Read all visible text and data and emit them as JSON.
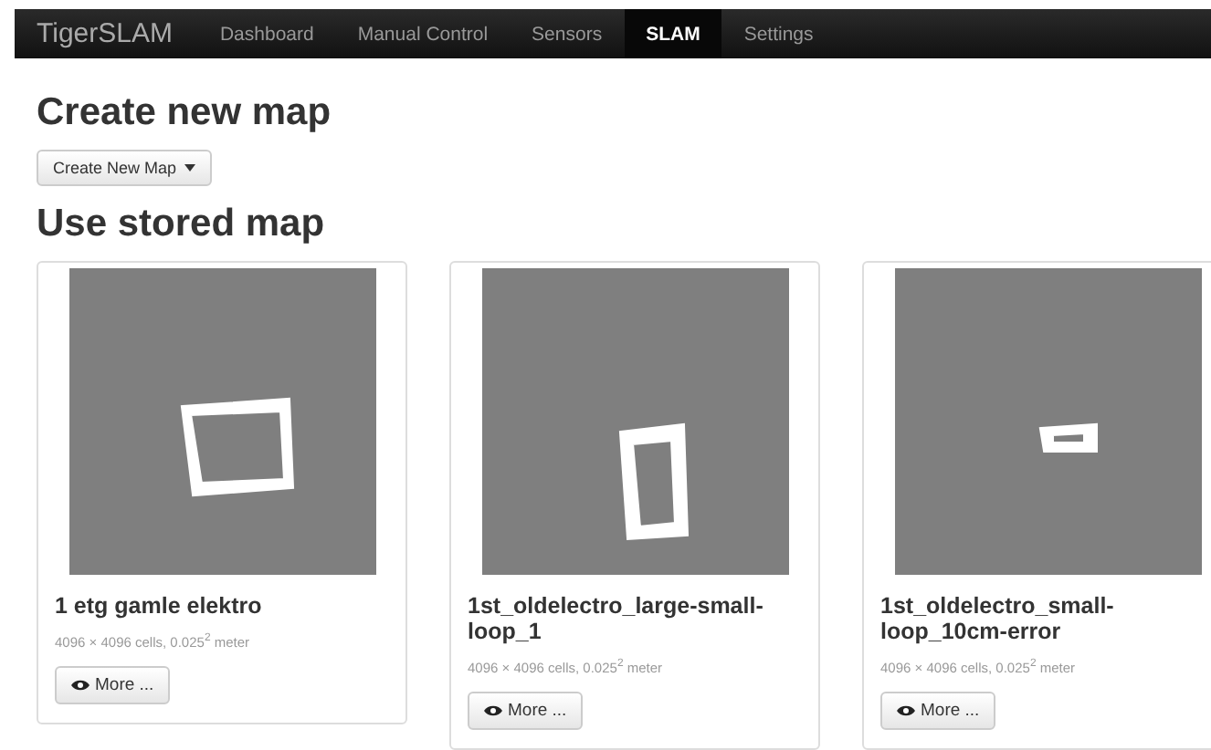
{
  "navbar": {
    "brand": "TigerSLAM",
    "items": [
      {
        "label": "Dashboard",
        "selected": false
      },
      {
        "label": "Manual Control",
        "selected": false
      },
      {
        "label": "Sensors",
        "selected": false
      },
      {
        "label": "SLAM",
        "selected": true
      },
      {
        "label": "Settings",
        "selected": false
      }
    ]
  },
  "create_section": {
    "heading": "Create new map",
    "button": "Create New Map"
  },
  "stored_section": {
    "heading": "Use stored map",
    "maps": [
      {
        "title": "1 etg gamle elektro",
        "info": "4096 × 4096 cells, 0.025$^{2}$ meter",
        "button": "More ..."
      },
      {
        "title": "1st_oldelectro_large-small-loop_1",
        "info": "4096 × 4096 cells, 0.025$^{2}$ meter",
        "button": "More ..."
      },
      {
        "title": "1st_oldelectro_small-loop_10cm-error",
        "info": "4096 × 4096 cells, 0.025$^{2}$ meter",
        "button": "More ..."
      }
    ]
  }
}
